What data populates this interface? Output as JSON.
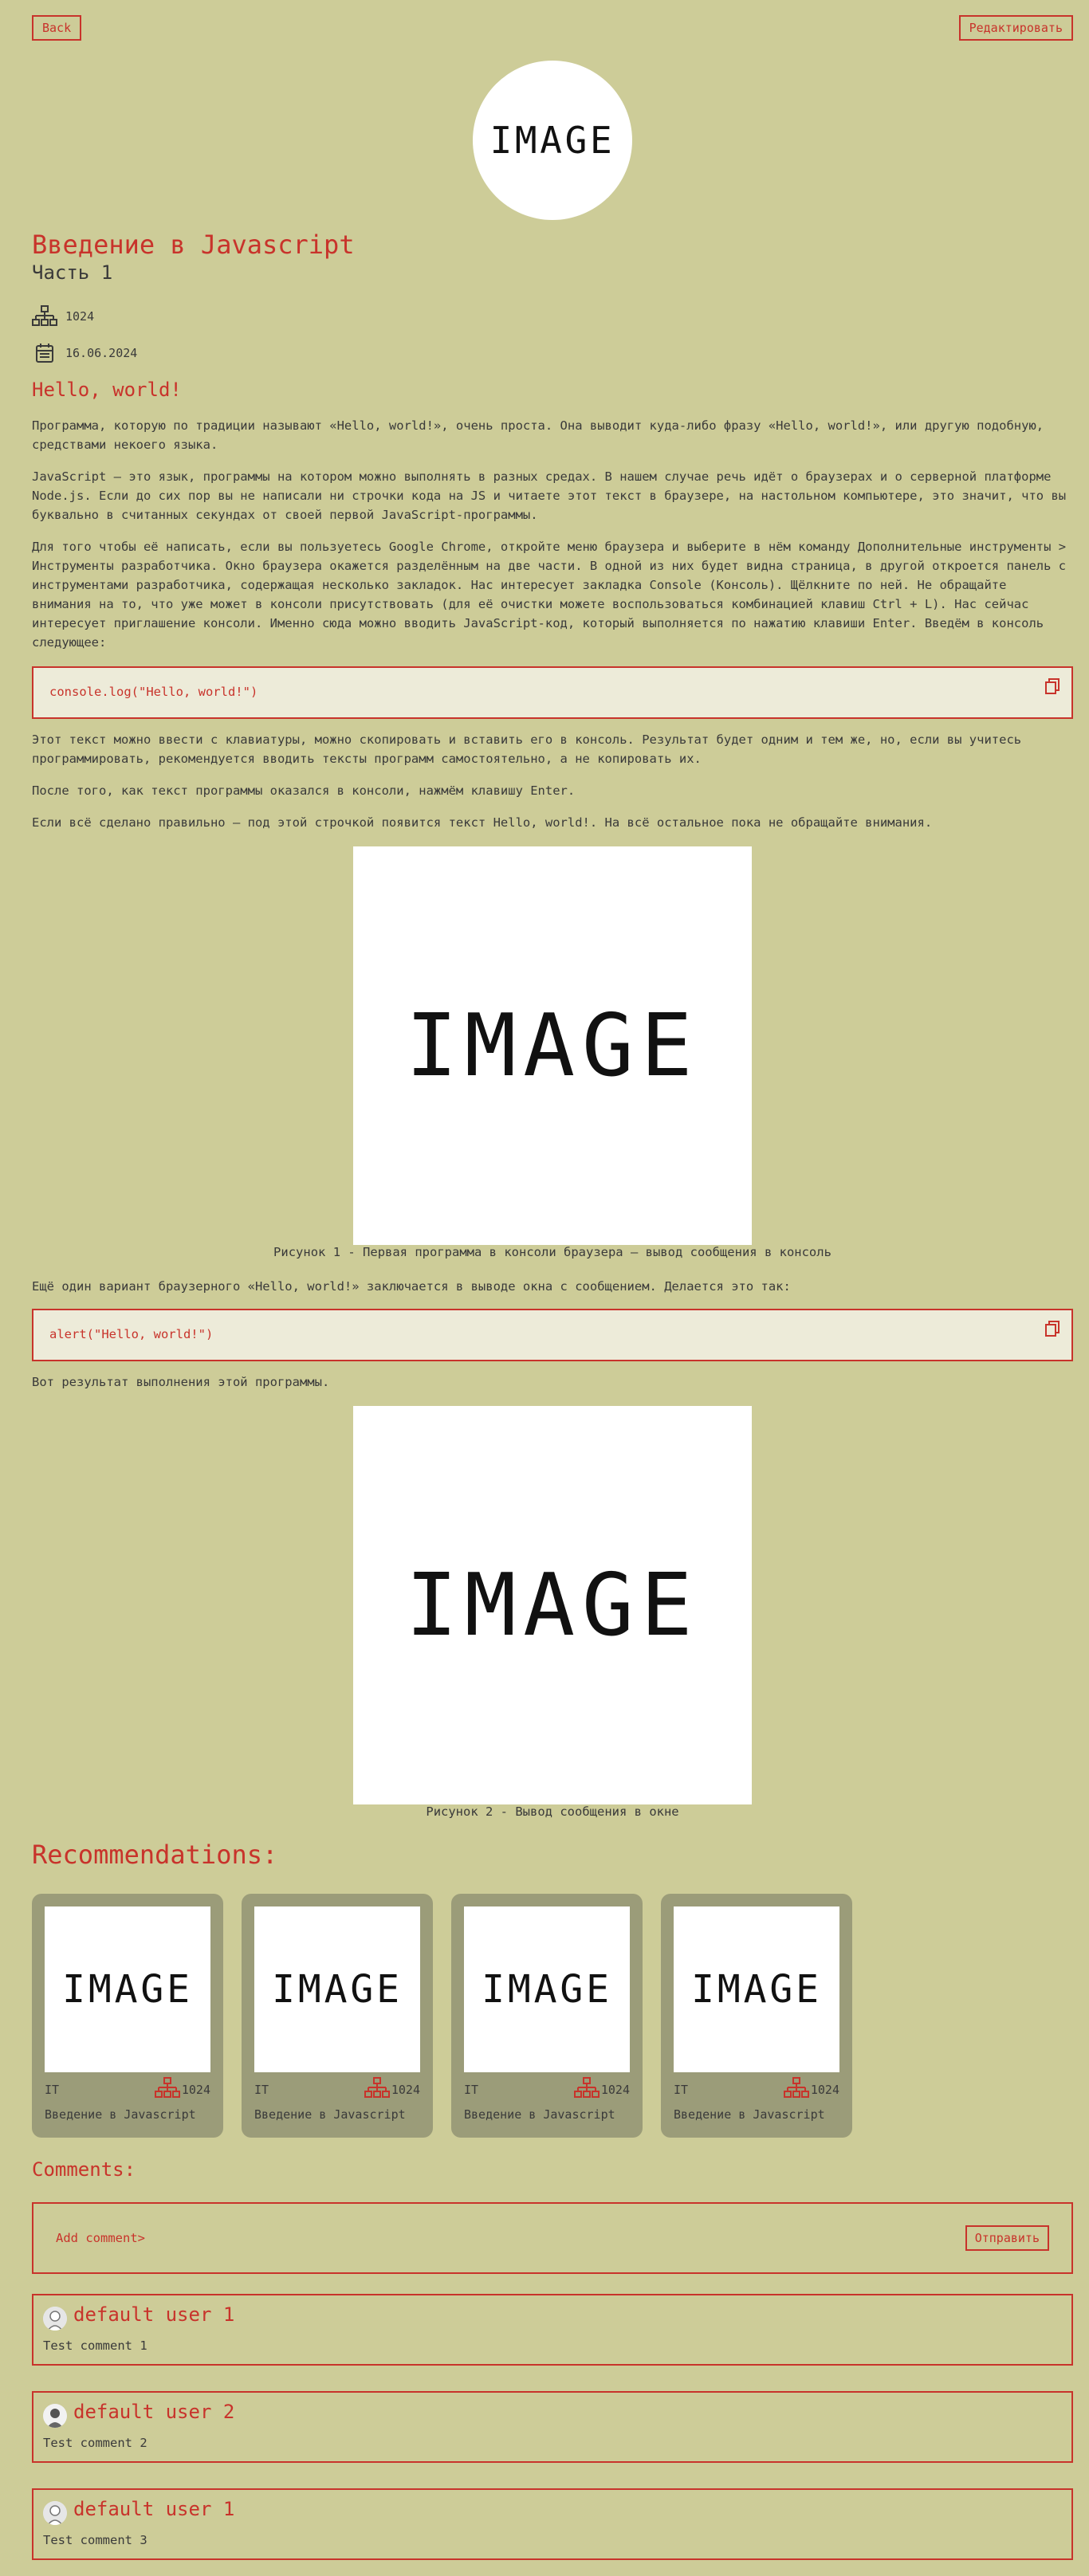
{
  "header": {
    "back_label": "Back",
    "edit_label": "Редактировать"
  },
  "article": {
    "hero_image_label": "IMAGE",
    "title": "Введение в Javascript",
    "subtitle": "Часть 1",
    "views": "1024",
    "date": "16.06.2024",
    "section_heading": "Hello, world!",
    "paragraphs": [
      "Программа, которую по традиции называют «Hello, world!», очень проста. Она выводит куда-либо фразу «Hello, world!», или другую подобную, средствами некоего языка.",
      "JavaScript — это язык, программы на котором можно выполнять в разных средах. В нашем случае речь идёт о браузерах и о серверной платформе Node.js. Если до сих пор вы не написали ни строчки кода на JS и читаете этот текст в браузере, на настольном компьютере, это значит, что вы буквально в считанных секундах от своей первой JavaScript-программы.",
      "Для того чтобы её написать, если вы пользуетесь Google Chrome, откройте меню браузера и выберите в нём команду Дополнительные инструменты > Инструменты разработчика. Окно браузера окажется разделённым на две части. В одной из них будет видна страница, в другой откроется панель с инструментами разработчика, содержащая несколько закладок. Нас интересует закладка Console (Консоль). Щёлкните по ней. Не обращайте внимания на то, что уже может в консоли присутствовать (для её очистки можете воспользоваться комбинацией клавиш Ctrl + L). Нас сейчас интересует приглашение консоли. Именно сюда можно вводить JavaScript-код, который выполняется по нажатию клавиши Enter. Введём в консоль следующее:",
      "Этот текст можно ввести с клавиатуры, можно скопировать и вставить его в консоль. Результат будет одним и тем же, но, если вы учитесь программировать, рекомендуется вводить тексты программ самостоятельно, а не копировать их.",
      "После того, как текст программы оказался в консоли, нажмём клавишу Enter.",
      "Если всё сделано правильно — под этой строчкой появится текст Hello, world!. На всё остальное пока не обращайте внимания.",
      "Ещё один вариант браузерного «Hello, world!» заключается в выводе окна с сообщением. Делается это так:",
      "Вот результат выполнения этой программы."
    ],
    "code_blocks": [
      "console.log(\"Hello, world!\")",
      "alert(\"Hello, world!\")"
    ],
    "figures": [
      {
        "image_label": "IMAGE",
        "caption": "Рисунок 1 - Первая программа в консоли браузера — вывод сообщения в консоль"
      },
      {
        "image_label": "IMAGE",
        "caption": "Рисунок 2 - Вывод сообщения в окне"
      }
    ]
  },
  "recommendations": {
    "title": "Recommendations:",
    "cards": [
      {
        "image_label": "IMAGE",
        "category": "IT",
        "views": "1024",
        "name": "Введение в Javascript"
      },
      {
        "image_label": "IMAGE",
        "category": "IT",
        "views": "1024",
        "name": "Введение в Javascript"
      },
      {
        "image_label": "IMAGE",
        "category": "IT",
        "views": "1024",
        "name": "Введение в Javascript"
      },
      {
        "image_label": "IMAGE",
        "category": "IT",
        "views": "1024",
        "name": "Введение в Javascript"
      }
    ]
  },
  "comments": {
    "title": "Comments:",
    "add_placeholder": "Add comment>",
    "send_label": "Отправить",
    "items": [
      {
        "user": "default user 1",
        "text": "Test comment 1"
      },
      {
        "user": "default user 2",
        "text": "Test comment 2"
      },
      {
        "user": "default user 1",
        "text": "Test comment 3"
      }
    ]
  },
  "colors": {
    "background": "#cdcc98",
    "accent": "#c8332b",
    "code_bg": "#edebd9",
    "card_bg": "#9b9c79",
    "text": "#3a3a3a"
  },
  "icons": {
    "views": "hierarchy-icon",
    "date": "calendar-icon",
    "copy": "copy-icon"
  }
}
